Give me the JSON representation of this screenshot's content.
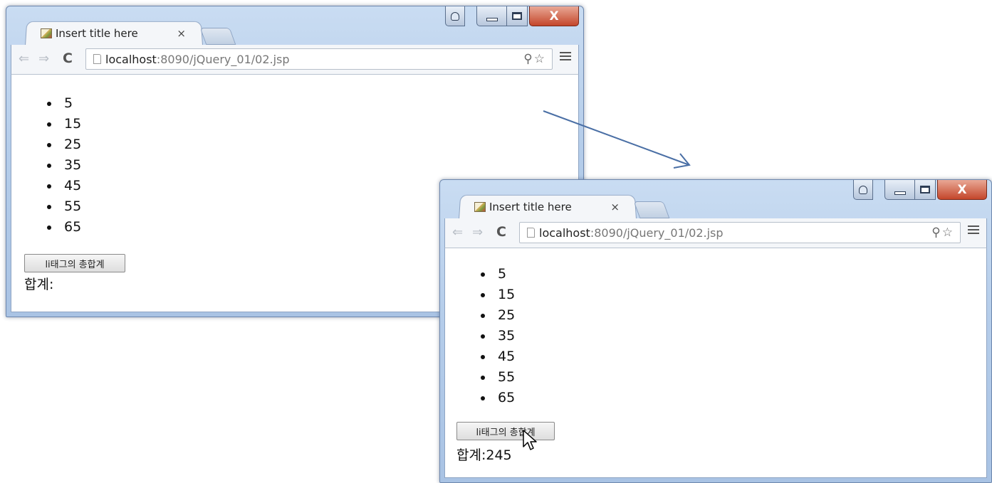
{
  "colors": {
    "window_frame": "#b5cdea",
    "close_button": "#c4462b",
    "arrow": "#4a6fa5"
  },
  "icons": [
    "page-favicon-icon",
    "back-arrow-icon",
    "forward-arrow-icon",
    "reload-icon",
    "page-icon",
    "zoom-icon",
    "star-icon",
    "menu-icon",
    "cursor-icon"
  ],
  "windows": [
    {
      "tab_title": "Insert title here",
      "tab_close": "×",
      "url_host": "localhost",
      "url_rest": ":8090/jQuery_01/02.jsp",
      "items": [
        "5",
        "15",
        "25",
        "35",
        "45",
        "55",
        "65"
      ],
      "button_label": "li태그의 총합계",
      "sum_text": "합계:"
    },
    {
      "tab_title": "Insert title here",
      "tab_close": "×",
      "url_host": "localhost",
      "url_rest": ":8090/jQuery_01/02.jsp",
      "items": [
        "5",
        "15",
        "25",
        "35",
        "45",
        "55",
        "65"
      ],
      "button_label": "li태그의 총합계",
      "sum_text": "합계:245"
    }
  ]
}
